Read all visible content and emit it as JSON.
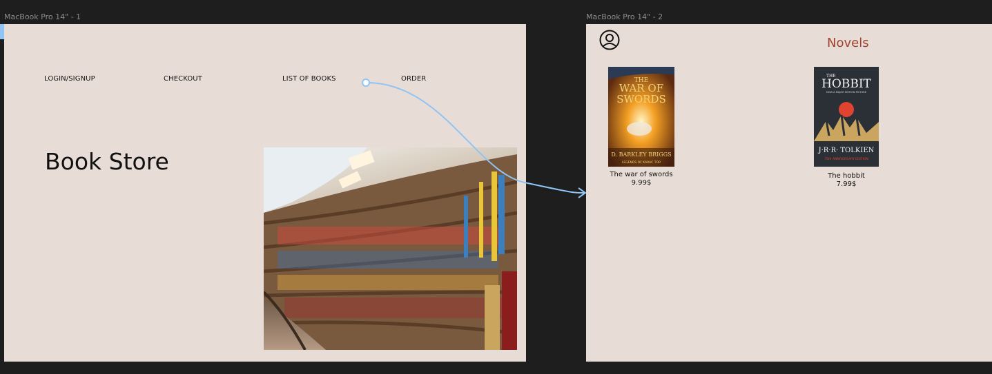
{
  "canvas": {
    "frame1_label": "MacBook Pro 14\" - 1",
    "frame2_label": "MacBook Pro 14\" - 2"
  },
  "home": {
    "nav": {
      "login": "LOGIN/SIGNUP",
      "checkout": "CHECKOUT",
      "list_of_books": "LIST OF BOOKS",
      "order": "ORDER"
    },
    "title": "Book Store"
  },
  "novels": {
    "heading": "Novels",
    "books": [
      {
        "title": "The war of swords",
        "price": "9.99$",
        "cover_title_line1": "THE",
        "cover_title_line2": "WAR OF",
        "cover_title_line3": "SWORDS",
        "cover_author": "D. BARKLEY BRIGGS",
        "cover_subtitle": "LEGENDS OF KARAC TOR"
      },
      {
        "title": "The hobbit",
        "price": "7.99$",
        "cover_title": "HOBBIT",
        "cover_the": "THE",
        "cover_tagline": "NOW A MAJOR MOTION PICTURE",
        "cover_author": "J·R·R· TOLKIEN",
        "cover_edition": "75th ANNIVERSARY EDITION"
      }
    ]
  },
  "colors": {
    "canvas_bg": "#1e1e1e",
    "frame_bg": "#e7ddd6",
    "accent_heading": "#a0422e",
    "prototype_link": "#8fc4f4"
  },
  "icons": {
    "avatar": "user-circle-icon"
  }
}
